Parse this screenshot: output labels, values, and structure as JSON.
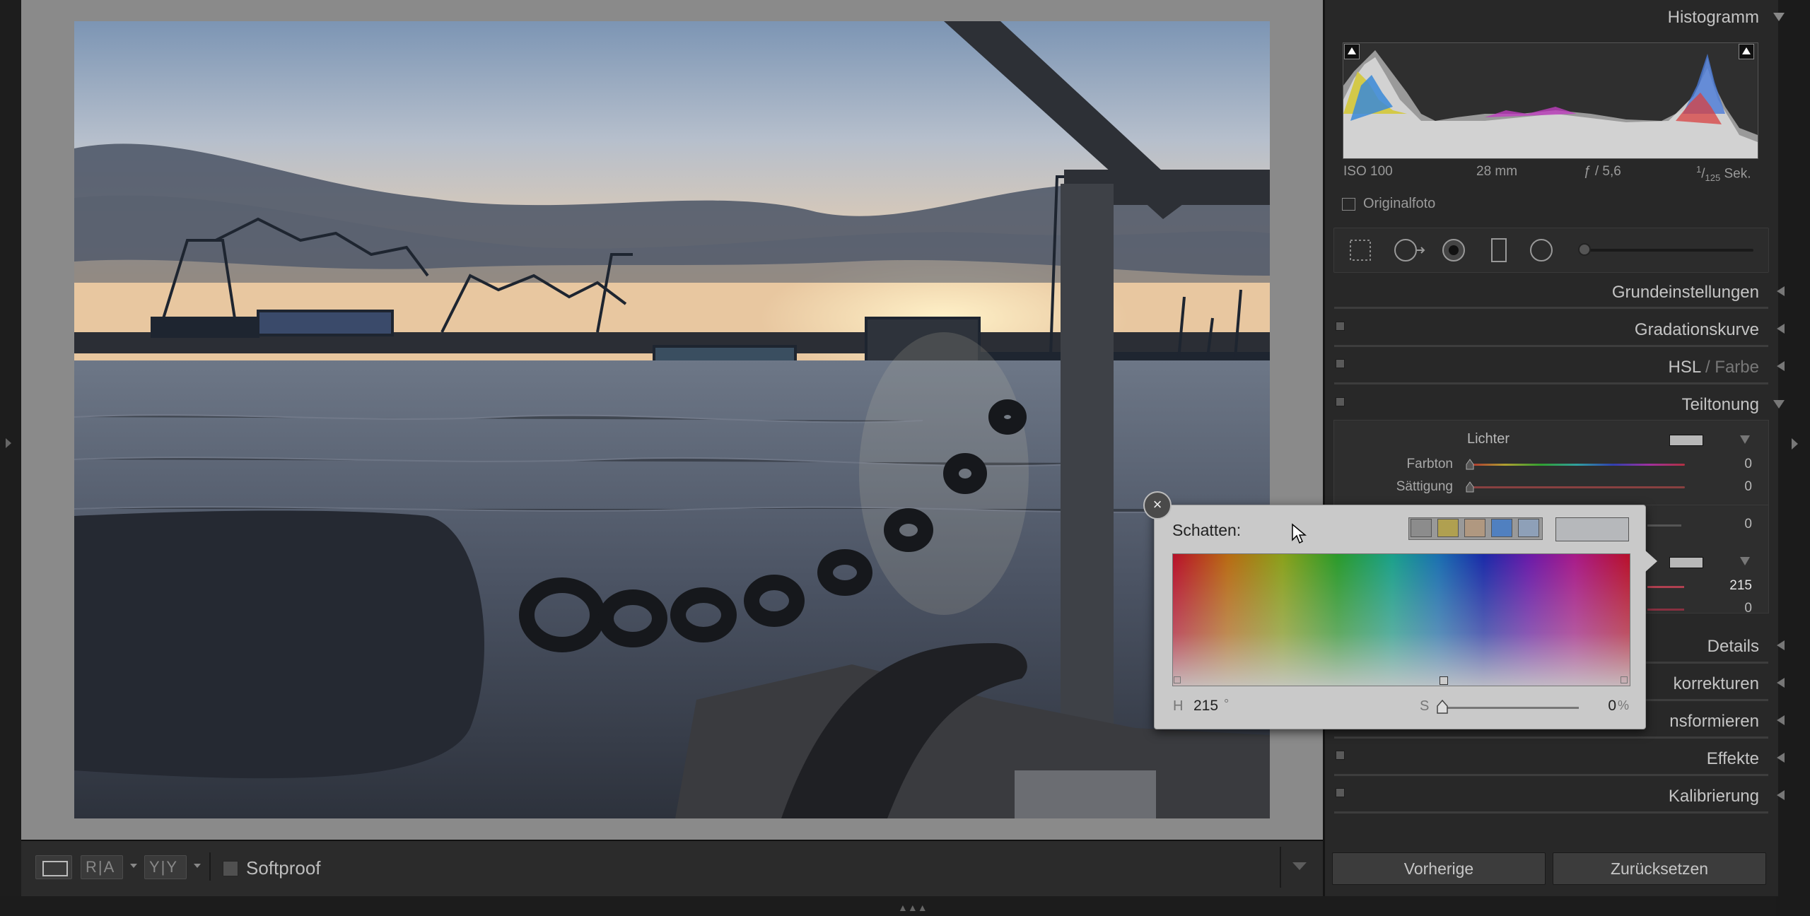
{
  "histogram": {
    "title": "Histogramm",
    "exif": {
      "iso": "ISO 100",
      "focal": "28 mm",
      "aperture": "ƒ / 5,6",
      "shutter_num": "1",
      "shutter_den": "125",
      "shutter_unit": "Sek."
    },
    "original_photo_label": "Originalfoto"
  },
  "panels": {
    "grundeinstellungen": "Grundeinstellungen",
    "gradationskurve": "Gradationskurve",
    "hsl_a": "HSL",
    "hsl_sep": " / ",
    "hsl_b": "Farbe",
    "teiltonung": "Teiltonung",
    "details": "Details",
    "korrekturen": "korrekturen",
    "transformieren": "nsformieren",
    "effekte": "Effekte",
    "kalibrierung": "Kalibrierung"
  },
  "split_toning": {
    "highlights_label": "Lichter",
    "hue_label": "Farbton",
    "hue_value": "0",
    "saturation_label": "Sättigung",
    "saturation_value": "0",
    "balance_value": "0",
    "shadows_hue_value": "215",
    "shadows_sat_value": "0"
  },
  "picker": {
    "title": "Schatten:",
    "close_symbol": "×",
    "presets": [
      "#8c8c8c",
      "#b0a050",
      "#b09880",
      "#5080c0",
      "#8ea0b8"
    ],
    "preview_color": "#b6b8bb",
    "h_label": "H",
    "h_value": "215",
    "h_unit": "°",
    "s_label": "S",
    "s_value": "0",
    "s_unit": "%"
  },
  "toolbar": {
    "view_ra": "R|A",
    "view_yy": "Y|Y",
    "softproof_label": "Softproof"
  },
  "buttons": {
    "previous": "Vorherige",
    "reset": "Zurücksetzen"
  }
}
